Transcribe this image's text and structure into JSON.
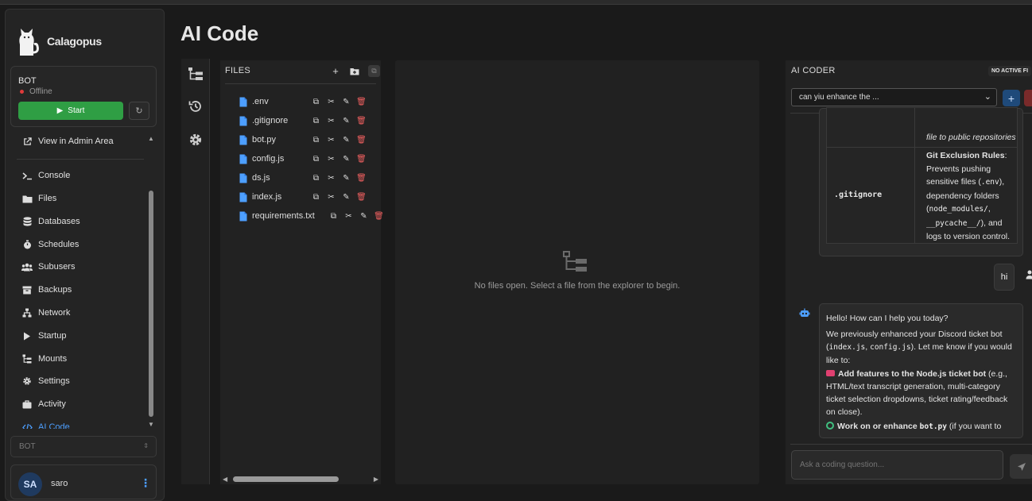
{
  "brand": {
    "name": "Calagopus"
  },
  "server": {
    "name": "BOT",
    "status": "Offline",
    "start_label": "Start"
  },
  "nav": {
    "admin_link": "View in Admin Area",
    "items": [
      {
        "label": "Console",
        "icon": "terminal-icon"
      },
      {
        "label": "Files",
        "icon": "folder-icon"
      },
      {
        "label": "Databases",
        "icon": "database-icon"
      },
      {
        "label": "Schedules",
        "icon": "stopwatch-icon"
      },
      {
        "label": "Subusers",
        "icon": "users-icon"
      },
      {
        "label": "Backups",
        "icon": "archive-icon"
      },
      {
        "label": "Network",
        "icon": "network-icon"
      },
      {
        "label": "Startup",
        "icon": "play-icon"
      },
      {
        "label": "Mounts",
        "icon": "mounts-icon"
      },
      {
        "label": "Settings",
        "icon": "gear-icon"
      },
      {
        "label": "Activity",
        "icon": "briefcase-icon"
      },
      {
        "label": "AI Code",
        "icon": "code-icon",
        "active": true
      }
    ]
  },
  "server_select": {
    "value": "BOT"
  },
  "user": {
    "initials": "SA",
    "name": "saro"
  },
  "page": {
    "title": "AI Code"
  },
  "explorer": {
    "title": "FILES",
    "files": [
      ".env",
      ".gitignore",
      "bot.py",
      "config.js",
      "ds.js",
      "index.js",
      "requirements.txt"
    ]
  },
  "editor": {
    "empty_text": "No files open. Select a file from the explorer to begin."
  },
  "ai": {
    "title": "AI CODER",
    "badge": "NO ACTIVE FI",
    "conversation": "can yiu enhance the ...",
    "table_tail_1": "file to public repositories",
    "gitignore_cell": ".gitignore",
    "git_rules_title": "Git Exclusion Rules",
    "git_rules_text": ": Prevents pushing sensitive files (",
    "env_code": ".env",
    "git_rules_text2": "), dependency folders (",
    "node_modules": "node_modules/",
    "pycache": "__pycache__/",
    "git_rules_text3": "), and logs to version control.",
    "user_msg": "hi",
    "bot_greeting": "Hello! How can I help you today?",
    "bot_p2a": "We previously enhanced your Discord ticket bot (",
    "bot_code1": "index.js",
    "bot_code2": "config.js",
    "bot_p2b": "). Let me know if you would like to:",
    "bot_b1_title": "Add features to the Node.js ticket bot",
    "bot_b1_text": " (e.g., HTML/text transcript generation, multi-category ticket selection dropdowns, ticket rating/feedback on close).",
    "bot_b2_title": "Work on or enhance",
    "bot_b2_code": "bot.py",
    "bot_b2_text": " (if you want to",
    "input_placeholder": "Ask a coding question..."
  }
}
